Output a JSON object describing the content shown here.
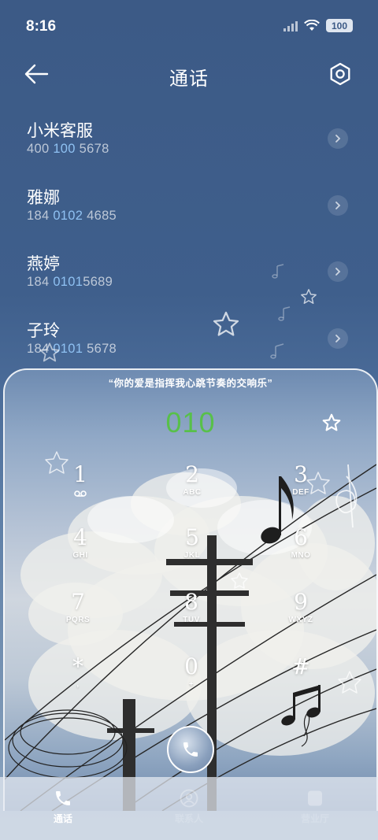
{
  "status_bar": {
    "time": "8:16",
    "battery": "100"
  },
  "header": {
    "title": "通话"
  },
  "contacts": [
    {
      "name": "小米客服",
      "number_pre": "400 ",
      "number_hl": "100",
      "number_post": " 5678"
    },
    {
      "name": "雅娜",
      "number_pre": "184 ",
      "number_hl": "0102",
      "number_post": " 4685"
    },
    {
      "name": "燕婷",
      "number_pre": "184 ",
      "number_hl": "0101",
      "number_post": "5689"
    },
    {
      "name": "子玲",
      "number_pre": "184 ",
      "number_hl": "0101",
      "number_post": " 5678"
    }
  ],
  "dialer": {
    "quote": "“你的爱是指挥我心跳节奏的交响乐”",
    "input": "010",
    "keys": [
      {
        "digit": "1",
        "letters": ""
      },
      {
        "digit": "2",
        "letters": "ABC"
      },
      {
        "digit": "3",
        "letters": "DEF"
      },
      {
        "digit": "4",
        "letters": "GHI"
      },
      {
        "digit": "5",
        "letters": "JKL"
      },
      {
        "digit": "6",
        "letters": "MNO"
      },
      {
        "digit": "7",
        "letters": "PQRS"
      },
      {
        "digit": "8",
        "letters": "TUV"
      },
      {
        "digit": "9",
        "letters": "WXYZ"
      },
      {
        "digit": "*",
        "letters": ","
      },
      {
        "digit": "0",
        "letters": "+"
      },
      {
        "digit": "#",
        "letters": ""
      }
    ]
  },
  "bottom_nav": [
    {
      "label": "通话",
      "icon": "phone-icon",
      "active": true
    },
    {
      "label": "联系人",
      "icon": "person-icon",
      "active": false
    },
    {
      "label": "营业厅",
      "icon": "store-icon",
      "active": false
    }
  ],
  "colors": {
    "accent_green": "#58c04a",
    "highlight_blue": "#8fc1f2",
    "bg_top": "#3c5a86"
  }
}
